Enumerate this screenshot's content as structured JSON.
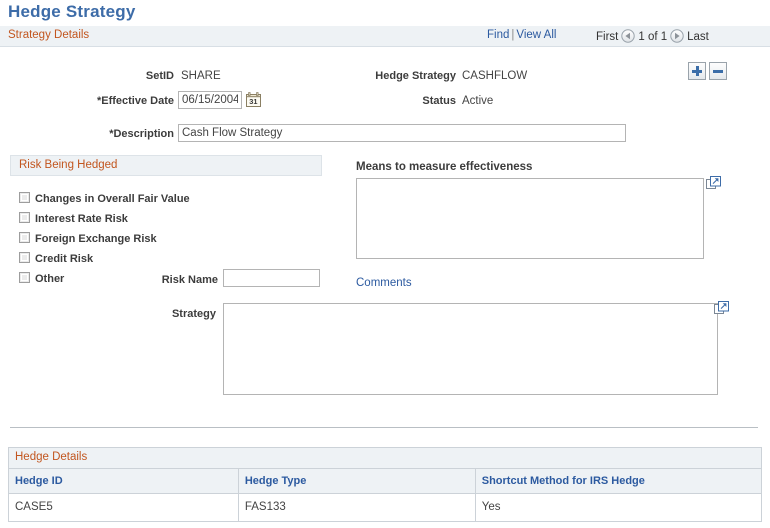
{
  "page": {
    "title": "Hedge Strategy"
  },
  "strategy_details": {
    "section_label": "Strategy Details",
    "nav": {
      "find_label": "Find",
      "separator": "|",
      "view_all_label": "View All",
      "first_label": "First",
      "prev_icon": "previous-arrow-icon",
      "position_label": "1 of 1",
      "next_icon": "next-arrow-icon",
      "last_label": "Last"
    },
    "row_buttons": {
      "add_label": "+",
      "delete_label": "-"
    },
    "fields": {
      "setid_label": "SetID",
      "setid_value": "SHARE",
      "hedge_strategy_label": "Hedge Strategy",
      "hedge_strategy_value": "CASHFLOW",
      "effective_date_label": "*Effective Date",
      "effective_date_value": "06/15/2004",
      "calendar_icon": "calendar-icon",
      "status_label": "Status",
      "status_value": "Active",
      "description_label": "*Description",
      "description_value": "Cash Flow Strategy"
    }
  },
  "risk_being_hedged": {
    "section_label": "Risk Being Hedged",
    "checkboxes": [
      {
        "label": "Changes in Overall Fair Value",
        "checked": false
      },
      {
        "label": "Interest Rate Risk",
        "checked": false
      },
      {
        "label": "Foreign Exchange Risk",
        "checked": false
      },
      {
        "label": "Credit Risk",
        "checked": false
      },
      {
        "label": "Other",
        "checked": false
      }
    ],
    "risk_name_label": "Risk Name",
    "risk_name_value": "",
    "risk_name_placeholder": ""
  },
  "effectiveness": {
    "label": "Means to measure effectiveness",
    "value": "",
    "placeholder": "",
    "expand_icon": "expand-icon",
    "comments_link": "Comments"
  },
  "strategy": {
    "label": "Strategy",
    "value": "",
    "placeholder": "",
    "expand_icon": "expand-icon"
  },
  "hedge_details": {
    "section_label": "Hedge Details",
    "columns": [
      "Hedge ID",
      "Hedge Type",
      "Shortcut Method for IRS Hedge"
    ],
    "rows": [
      [
        "CASE5",
        "FAS133",
        "Yes"
      ]
    ]
  },
  "colors": {
    "title_blue": "#3d6ca8",
    "section_orange": "#c2561f",
    "link_blue": "#2c5aa0",
    "section_bar_bg": "#eef2f5",
    "accent_button_blue": "#3b6da8"
  }
}
